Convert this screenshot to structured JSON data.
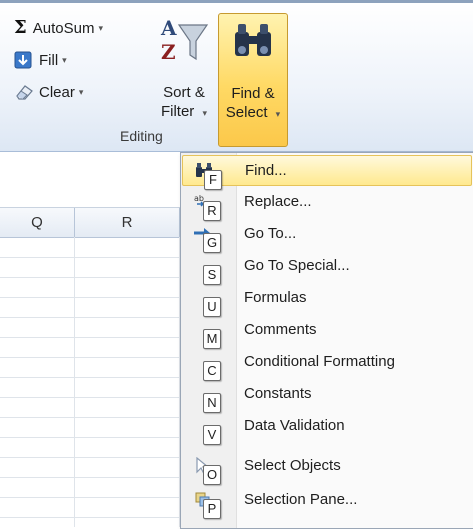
{
  "ribbon": {
    "autosum_label": "AutoSum",
    "fill_label": "Fill",
    "clear_label": "Clear",
    "sort_filter_line1": "Sort &",
    "sort_filter_line2": "Filter",
    "find_select_line1": "Find &",
    "find_select_line2": "Select",
    "group_label": "Editing",
    "dropdown_arrow": "▾"
  },
  "grid": {
    "columns": [
      "Q",
      "R"
    ]
  },
  "menu": {
    "items": [
      {
        "label": "Find...",
        "key": "F",
        "icon": "binoculars-icon",
        "highlighted": true
      },
      {
        "label": "Replace...",
        "key": "R",
        "icon": "replace-icon"
      },
      {
        "label": "Go To...",
        "key": "G",
        "icon": "goto-arrow-icon"
      },
      {
        "label": "Go To Special...",
        "key": "S",
        "icon": ""
      },
      {
        "label": "Formulas",
        "key": "U",
        "icon": ""
      },
      {
        "label": "Comments",
        "key": "M",
        "icon": ""
      },
      {
        "label": "Conditional Formatting",
        "key": "C",
        "icon": ""
      },
      {
        "label": "Constants",
        "key": "N",
        "icon": ""
      },
      {
        "label": "Data Validation",
        "key": "V",
        "icon": ""
      },
      {
        "label": "Select Objects",
        "key": "O",
        "icon": "pointer-icon"
      },
      {
        "label": "Selection Pane...",
        "key": "P",
        "icon": "selection-pane-icon"
      }
    ]
  },
  "colors": {
    "highlight": "#ffe98e",
    "ribbon_bg": "#eef3fa",
    "accent_border": "#c69a30"
  }
}
